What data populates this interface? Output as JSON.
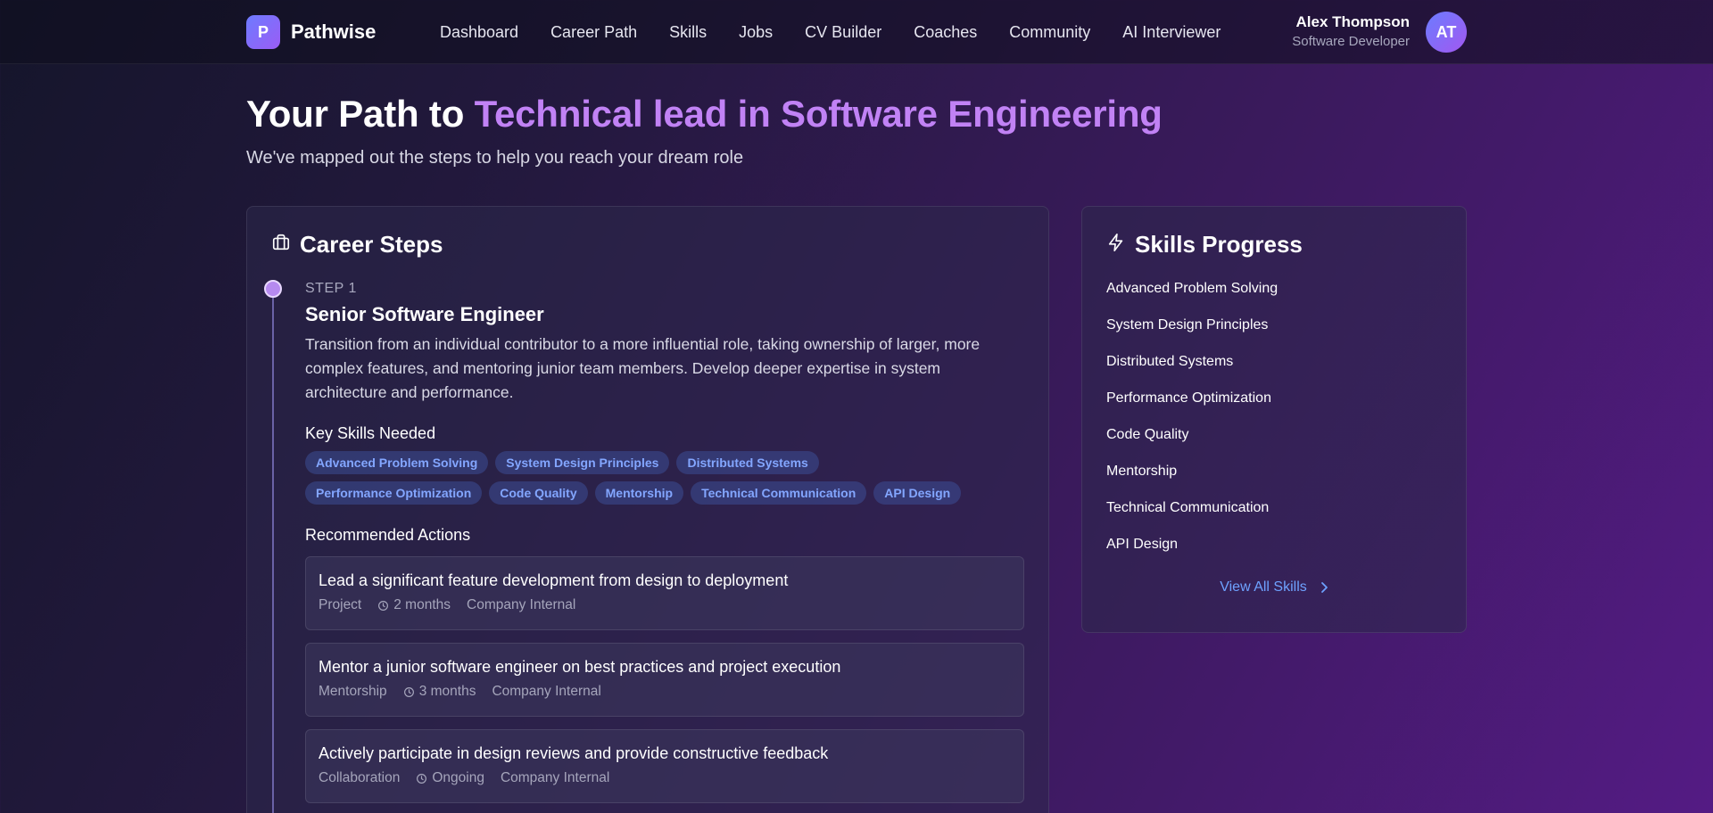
{
  "app": {
    "logo_letter": "P",
    "name": "Pathwise"
  },
  "nav": {
    "items": [
      "Dashboard",
      "Career Path",
      "Skills",
      "Jobs",
      "CV Builder",
      "Coaches",
      "Community",
      "AI Interviewer"
    ]
  },
  "user": {
    "name": "Alex Thompson",
    "role": "Software Developer",
    "initials": "AT"
  },
  "hero": {
    "title_prefix": "Your Path to ",
    "title_accent": "Technical lead in Software Engineering",
    "subtitle": "We've mapped out the steps to help you reach your dream role"
  },
  "career": {
    "title": "Career Steps",
    "icon": "briefcase-icon",
    "step": {
      "label": "STEP 1",
      "title": "Senior Software Engineer",
      "description": "Transition from an individual contributor to a more influential role, taking ownership of larger, more complex features, and mentoring junior team members. Develop deeper expertise in system architecture and performance.",
      "skills_label": "Key Skills Needed",
      "skills": [
        "Advanced Problem Solving",
        "System Design Principles",
        "Distributed Systems",
        "Performance Optimization",
        "Code Quality",
        "Mentorship",
        "Technical Communication",
        "API Design"
      ],
      "actions_label": "Recommended Actions",
      "actions": [
        {
          "title": "Lead a significant feature development from design to deployment",
          "type": "Project",
          "duration": "2 months",
          "provider": "Company Internal"
        },
        {
          "title": "Mentor a junior software engineer on best practices and project execution",
          "type": "Mentorship",
          "duration": "3 months",
          "provider": "Company Internal"
        },
        {
          "title": "Actively participate in design reviews and provide constructive feedback",
          "type": "Collaboration",
          "duration": "Ongoing",
          "provider": "Company Internal"
        }
      ]
    }
  },
  "skills_progress": {
    "title": "Skills Progress",
    "icon": "lightning-icon",
    "items": [
      "Advanced Problem Solving",
      "System Design Principles",
      "Distributed Systems",
      "Performance Optimization",
      "Code Quality",
      "Mentorship",
      "Technical Communication",
      "API Design"
    ],
    "view_all": "View All Skills"
  },
  "colors": {
    "accent": "#c182f5",
    "link": "#6ea2ff",
    "tag_text": "#83a6ff"
  }
}
